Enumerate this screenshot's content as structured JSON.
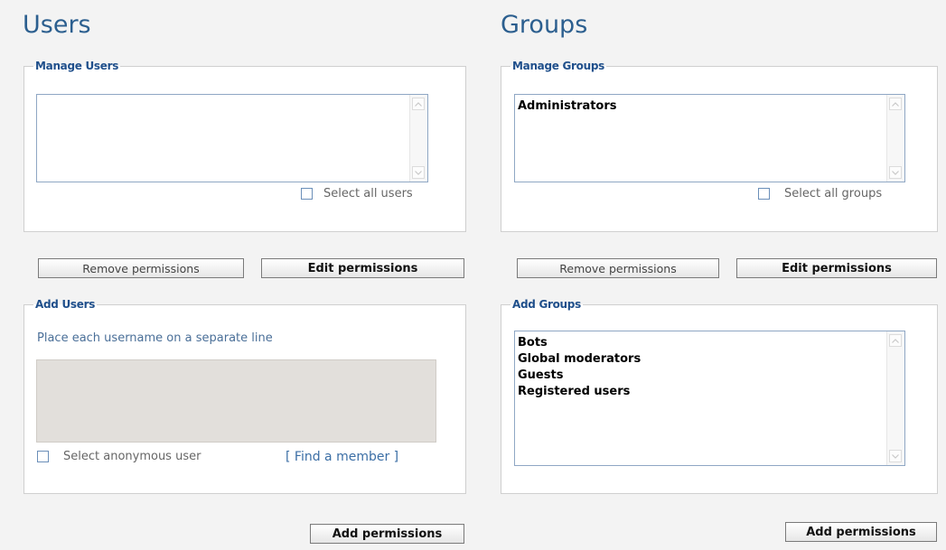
{
  "users": {
    "title": "Users",
    "manage": {
      "legend": "Manage Users",
      "items": [],
      "select_all_label": "Select all users"
    },
    "buttons": {
      "remove": "Remove permissions",
      "edit": "Edit permissions"
    },
    "add": {
      "legend": "Add Users",
      "hint": "Place each username on a separate line",
      "textarea_value": "",
      "anonymous_label": "Select anonymous user",
      "find_member": "[ Find a member ]"
    },
    "add_button": "Add permissions"
  },
  "groups": {
    "title": "Groups",
    "manage": {
      "legend": "Manage Groups",
      "items": [
        "Administrators"
      ],
      "select_all_label": "Select all groups"
    },
    "buttons": {
      "remove": "Remove permissions",
      "edit": "Edit permissions"
    },
    "add": {
      "legend": "Add Groups",
      "items": [
        "Bots",
        "Global moderators",
        "Guests",
        "Registered users"
      ]
    },
    "add_button": "Add permissions"
  },
  "icons": {
    "scroll_up": "chevron-up-icon",
    "scroll_down": "chevron-down-icon"
  },
  "colors": {
    "title": "#2c5f8f",
    "legend": "#1f4f8b",
    "background": "#f3f3f3",
    "textarea": "#e2dfdb"
  }
}
